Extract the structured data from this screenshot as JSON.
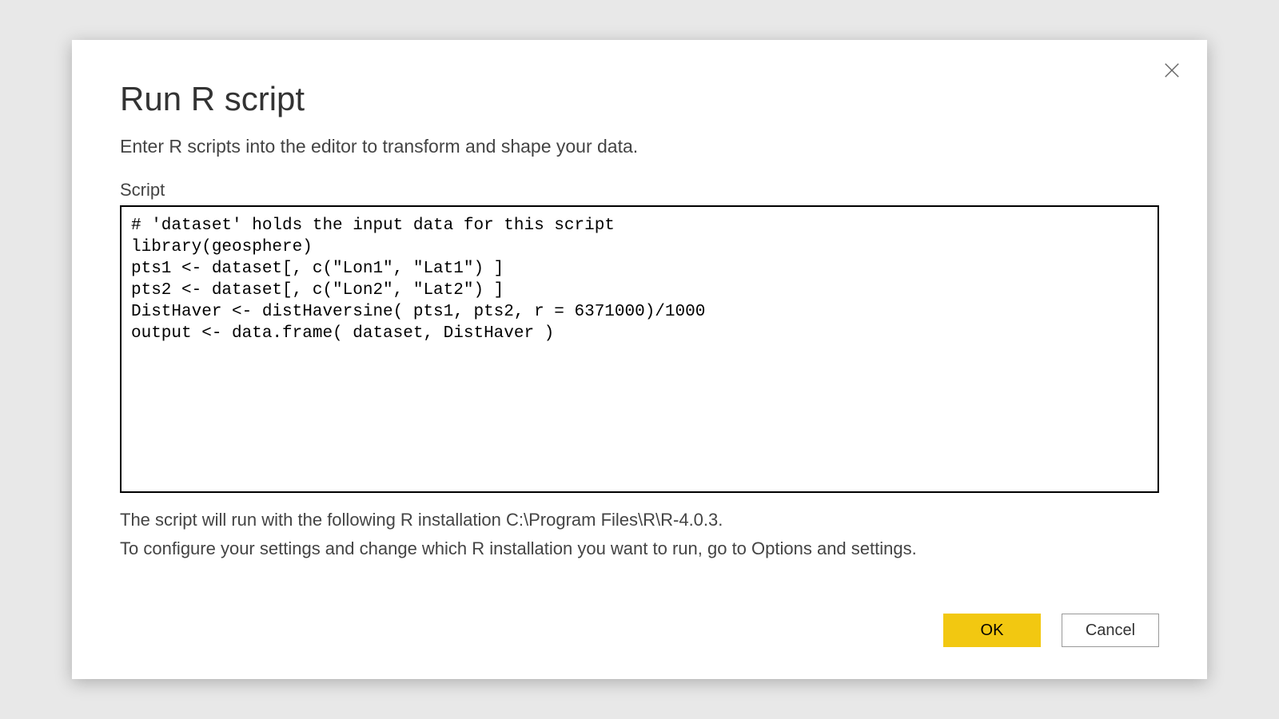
{
  "dialog": {
    "title": "Run R script",
    "subtitle": "Enter R scripts into the editor to transform and shape your data.",
    "script_label": "Script",
    "script_value": "# 'dataset' holds the input data for this script\nlibrary(geosphere)\npts1 <- dataset[, c(\"Lon1\", \"Lat1\") ]\npts2 <- dataset[, c(\"Lon2\", \"Lat2\") ]\nDistHaver <- distHaversine( pts1, pts2, r = 6371000)/1000\noutput <- data.frame( dataset, DistHaver )",
    "install_line1": "The script will run with the following R installation C:\\Program Files\\R\\R-4.0.3.",
    "install_line2": "To configure your settings and change which R installation you want to run, go to Options and settings.",
    "ok_label": "OK",
    "cancel_label": "Cancel"
  }
}
